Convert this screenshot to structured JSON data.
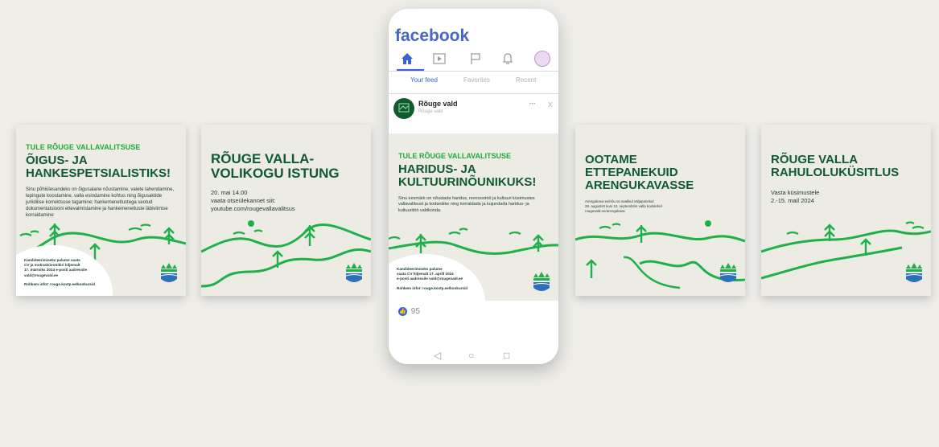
{
  "colors": {
    "highlight_green": "#22a83a",
    "title_green": "#0f5a2e",
    "hills_green": "#1fb04b",
    "facebook_blue": "#4667c9",
    "card_bg": "#ecebe4",
    "page_bg": "#eeede8"
  },
  "cards": [
    {
      "kicker": "TULE RÕUGE VALLAVALITSUSE",
      "title_line1": "ÕIGUS- JA",
      "title_line2": "HANKESPETSIALISTIKS!",
      "body": "Sinu põhiülesandeks on õigusalane nõustamine, vaiete lahendamine, lepingute koostamine, valla esindamine kohtus ning õigusaktide juriidilise korrektsuse tagamine; hankemenetlustega seotud dokumentatsiooni ettevalmistamine ja hankemenetluste läbiviimise korraldamine",
      "footer1": "Kandideerimiseks palume saata",
      "footer2": "CV ja motivatsioonikiri hiljemalt",
      "footer3": "17. märtsiks 2024 e-posti aadressile",
      "footer4": "vald@rougevald.ee",
      "footer5": "Rohkem infot: rouge.kovtp.ee/konkursid"
    },
    {
      "title_line1": "RÕUGE VALLA-",
      "title_line2": "VOLIKOGU ISTUNG",
      "line1": "20. mai 14.00",
      "line2": "vaata otseülekannet siit:",
      "line3": "youtube.com/rougevallavalitsus"
    },
    {
      "title_line1": "OOTAME",
      "title_line2": "ETTEPANEKUID",
      "title_line3": "ARENGUKAVASSE",
      "line1": "Arengukava eelnõu on avalikul väljapanekul",
      "line2": "28. augustist kuni 10. septembrini valla kodulehel",
      "line3": "rougevald.ee/arengukava"
    },
    {
      "title_line1": "RÕUGE VALLA",
      "title_line2": "RAHULOLUKÜSITLUS",
      "line1": "Vasta küsimustele",
      "line2": "2.-15. mail 2024"
    }
  ],
  "phone": {
    "app_title": "facebook",
    "nav_icons": [
      "home-icon",
      "video-icon",
      "flag-icon",
      "bell-icon",
      "profile-avatar"
    ],
    "tabs": [
      "Your feed",
      "Favorites",
      "Recent"
    ],
    "post": {
      "author": "Rõuge vald",
      "subtitle": "Rõuge vald",
      "more": "•••",
      "close": "X",
      "kicker": "TULE RÕUGE VALLAVALITSUSE",
      "title_line1": "HARIDUS- JA",
      "title_line2": "KULTUURINÕUNIKUKS!",
      "body": "Sinu eesmärk on nõustada haridus, noorsootöö ja kultuuri küsimustes vallavalitsust ja kodanikke ning korraldada ja kujundada haridus- ja kultuuritöö valdkonda.",
      "footer1": "Kandideerimiseks palume",
      "footer2": "saata CV hiljemalt 17. aprill 2024",
      "footer3": "e-posti aadressile vald@rougevald.ee",
      "footer4": "Rohkem infot: rouge.kovtp.ee/konkursid",
      "likes": "95"
    },
    "system_nav": [
      "◁",
      "○",
      "□"
    ]
  }
}
